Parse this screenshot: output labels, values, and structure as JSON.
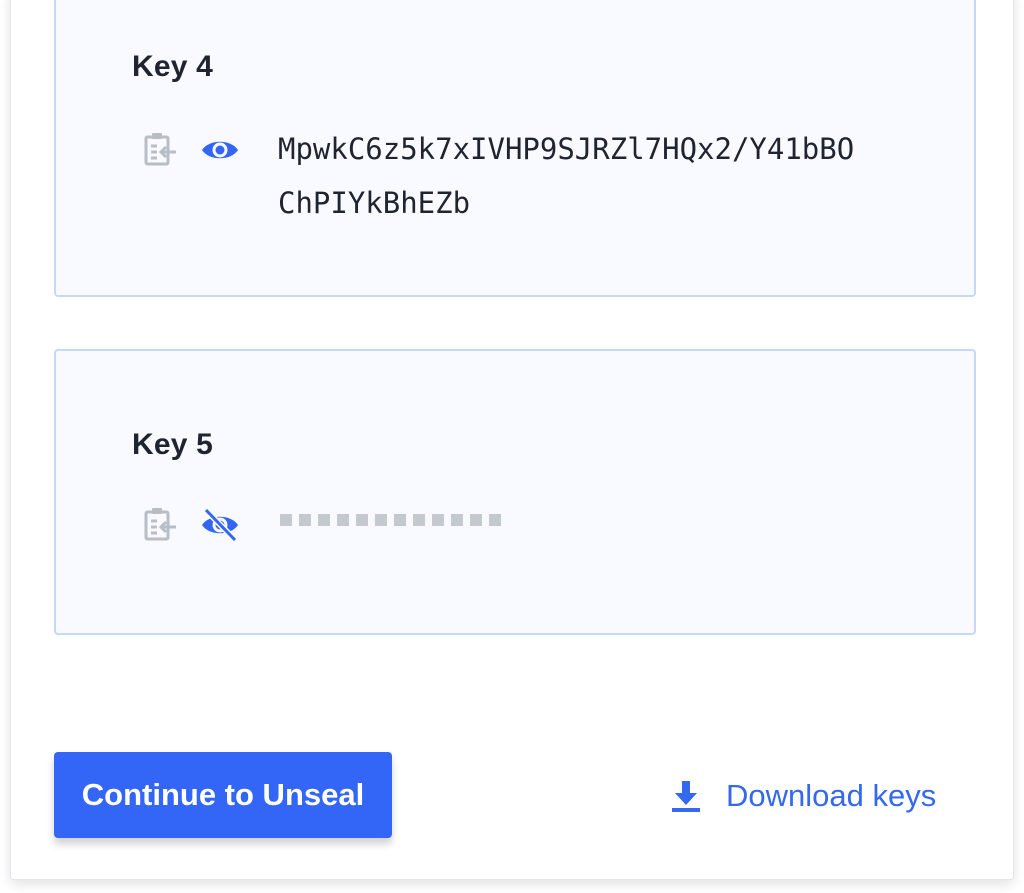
{
  "keys": [
    {
      "title": "Key 4",
      "visible": true,
      "value": "MpwkC6z5k7xIVHP9SJRZl7HQx2/Y41bBOChPIYkBhEZb"
    },
    {
      "title": "Key 5",
      "visible": false,
      "masked_dots": 12
    }
  ],
  "actions": {
    "continue_label": "Continue to Unseal",
    "download_label": "Download keys"
  },
  "colors": {
    "primary": "#3366f6",
    "link": "#3468ee",
    "card_bg": "#f8faff",
    "card_border": "#c7d8f5",
    "icon_muted": "#b9bec6"
  },
  "icons": {
    "copy": "clipboard-copy-icon",
    "show": "eye-icon",
    "hide": "eye-off-icon",
    "download": "download-icon"
  }
}
